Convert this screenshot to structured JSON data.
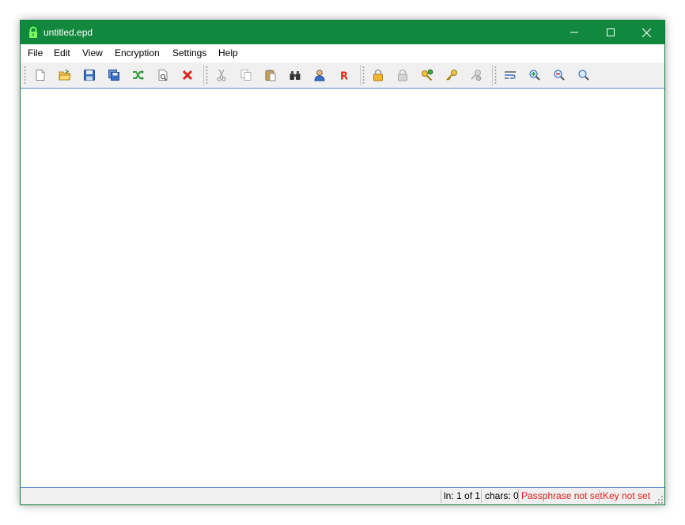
{
  "window": {
    "title": "untitled.epd",
    "app_icon": "green-padlock-icon",
    "controls": [
      "minimize-icon",
      "maximize-icon",
      "close-icon"
    ]
  },
  "menu": {
    "items": [
      {
        "label": "File"
      },
      {
        "label": "Edit"
      },
      {
        "label": "View"
      },
      {
        "label": "Encryption"
      },
      {
        "label": "Settings"
      },
      {
        "label": "Help"
      }
    ]
  },
  "toolbar": {
    "groups": [
      [
        "new-document-icon",
        "open-folder-icon",
        "save-icon",
        "save-as-icon",
        "shuffle-icon",
        "preview-icon",
        "delete-icon"
      ],
      [
        "cut-icon",
        "copy-icon",
        "paste-icon",
        "binoculars-icon",
        "user-icon",
        "r-icon"
      ],
      [
        "lock-icon",
        "lock-disabled-icon",
        "key-add-icon",
        "key-icon",
        "key-disabled-icon"
      ],
      [
        "word-wrap-icon",
        "zoom-in-icon",
        "zoom-out-icon",
        "zoom-reset-icon"
      ]
    ]
  },
  "editor": {
    "content": ""
  },
  "status": {
    "position": "ln: 1 of 1",
    "chars": "chars: 0",
    "passphrase": "Passphrase not set",
    "key": "Key not set"
  },
  "colors": {
    "titlebar": "#12883e",
    "status_warning": "#e0201f",
    "editor_border": "#5a8fd0"
  }
}
